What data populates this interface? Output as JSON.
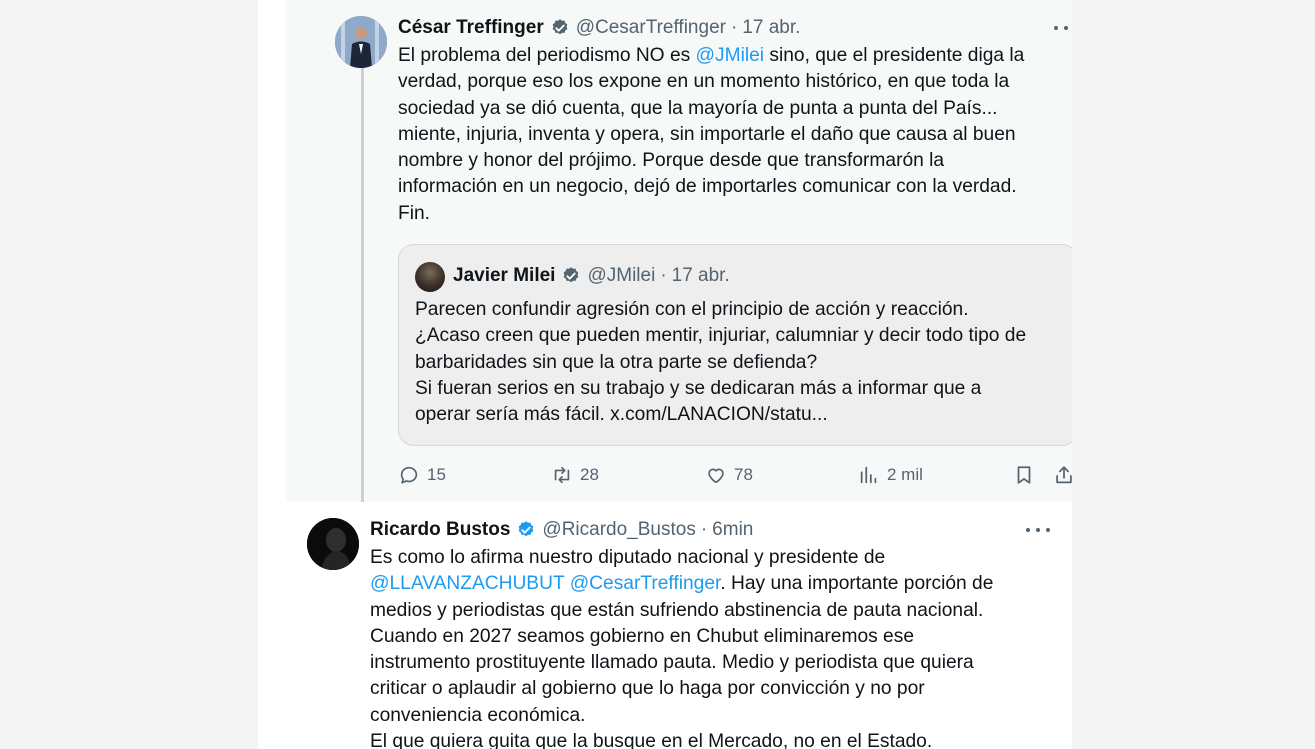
{
  "thread": {
    "tweet1": {
      "author_name": "César Treffinger",
      "handle": "@CesarTreffinger",
      "separator": "·",
      "time": "17 abr.",
      "text_before": "El problema del periodismo NO es ",
      "mention": "@JMilei",
      "text_after": " sino, que el presidente diga la\nverdad, porque eso los expone en un momento histórico, en que toda la\nsociedad ya se dió cuenta, que la mayoría de punta a punta del País...\nmiente, injuria, inventa y opera, sin importarle el daño que causa al buen\nnombre y honor del prójimo. Porque desde que transformarón la\ninformación en un negocio, dejó de importarles comunicar con la verdad.\nFin.",
      "quote": {
        "author_name": "Javier Milei",
        "handle": "@JMilei",
        "separator": "·",
        "time": "17 abr.",
        "text": "Parecen confundir agresión con el principio de acción y reacción.\n¿Acaso creen que pueden mentir, injuriar, calumniar y decir todo tipo de\nbarbaridades sin que la otra parte se defienda?\nSi fueran serios en su trabajo y se dedicaran más a informar que a\noperar sería más fácil. x.com/LANACION/statu..."
      },
      "actions": {
        "replies": "15",
        "retweets": "28",
        "likes": "78",
        "views": "2 mil"
      }
    },
    "tweet2": {
      "author_name": "Ricardo Bustos",
      "handle": "@Ricardo_Bustos",
      "separator": "·",
      "time": "6min",
      "text_line1": "Es como lo afirma nuestro diputado nacional y presidente de\n",
      "mention1": "@LLAVANZACHUBUT",
      "space": " ",
      "mention2": "@CesarTreffinger",
      "text_rest": ". Hay una importante porción de\nmedios y periodistas que están sufriendo abstinencia de pauta nacional.\nCuando en 2027 seamos gobierno en Chubut eliminaremos ese\ninstrumento prostituyente llamado pauta. Medio y periodista que quiera\ncriticar o aplaudir al gobierno que lo haga por convicción y no por\nconveniencia económica.\nEl que quiera guita que la busque en el Mercado, no en el Estado."
    }
  },
  "colors": {
    "accent": "#1d9bf0",
    "secondary_text": "#536471",
    "primary_text": "#0f1419"
  },
  "icons": [
    "verified-badge-icon",
    "more-icon",
    "reply-icon",
    "retweet-icon",
    "like-icon",
    "views-icon",
    "bookmark-icon",
    "share-icon"
  ]
}
